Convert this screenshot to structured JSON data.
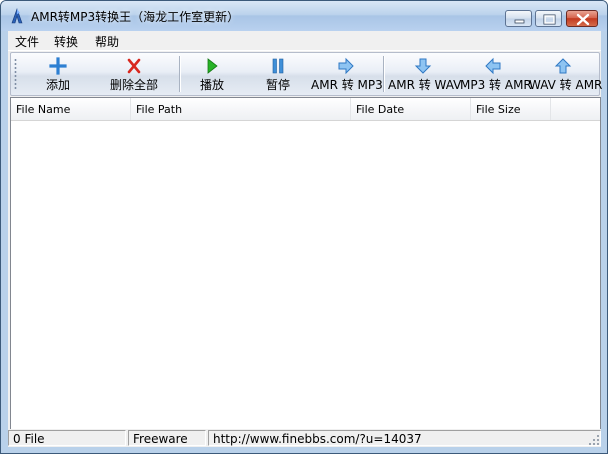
{
  "window": {
    "title": "AMR转MP3转换王（海龙工作室更新）",
    "accent": "#b9d1ea"
  },
  "menu": {
    "items": [
      {
        "label": "文件"
      },
      {
        "label": "转换"
      },
      {
        "label": "帮助"
      }
    ]
  },
  "toolbar": {
    "buttons": [
      {
        "label": "添加",
        "icon": "plus-icon"
      },
      {
        "label": "删除全部",
        "icon": "red-x-icon"
      },
      {
        "label": "播放",
        "icon": "play-icon"
      },
      {
        "label": "暂停",
        "icon": "pause-icon"
      },
      {
        "label": "AMR 转 MP3",
        "icon": "arrow-right-icon"
      },
      {
        "label": "AMR 转 WAV",
        "icon": "arrow-down-icon"
      },
      {
        "label": "MP3 转 AMR",
        "icon": "arrow-left-icon"
      },
      {
        "label": "WAV 转 AMR",
        "icon": "arrow-up-icon"
      }
    ]
  },
  "list": {
    "columns": [
      {
        "label": "File Name"
      },
      {
        "label": "File Path"
      },
      {
        "label": "File Date"
      },
      {
        "label": "File Size"
      }
    ],
    "rows": []
  },
  "status": {
    "count": "0 File",
    "license": "Freeware",
    "url": "http://www.finebbs.com/?u=14037"
  }
}
